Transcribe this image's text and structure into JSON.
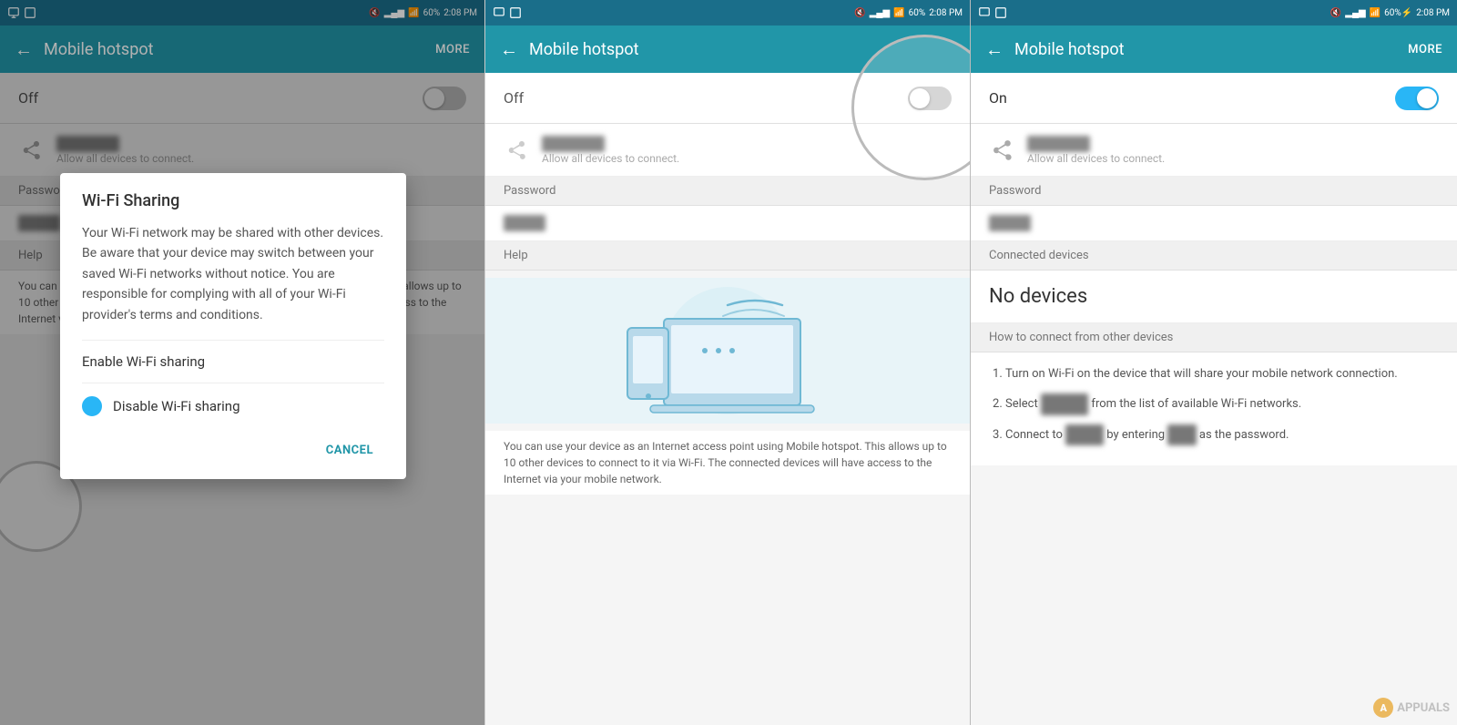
{
  "panel1": {
    "status": {
      "time": "2:08 PM",
      "battery": "60%",
      "signal": "4G"
    },
    "header": {
      "title": "Mobile hotspot",
      "more": "MORE",
      "back": "←"
    },
    "toggle": {
      "label": "Off",
      "state": "off"
    },
    "dialog": {
      "title": "Wi-Fi Sharing",
      "body": "Your Wi-Fi network may be shared with other devices. Be aware that your device may switch between your saved Wi-Fi networks without notice. You are responsible for complying with all of your Wi-Fi provider's terms and conditions.",
      "option1": "Enable Wi-Fi sharing",
      "option2": "Disable Wi-Fi sharing",
      "cancel": "CANCEL"
    },
    "footer_text": "You can use your device as an Internet access point using Mobile hotspot. This allows up to 10 other devices to connect to it via Wi-Fi. The connected devices will have access to the Internet via your mobile network."
  },
  "panel2": {
    "status": {
      "time": "2:08 PM",
      "battery": "60%"
    },
    "header": {
      "title": "Mobile hotspot",
      "back": "←"
    },
    "toggle": {
      "label": "Off",
      "state": "off"
    },
    "network_label": "Allow all devices to connect.",
    "password_label": "Password",
    "help_label": "Help",
    "help_text": "You can use your device as an Internet access point using Mobile hotspot. This allows up to 10 other devices to connect to it via Wi-Fi. The connected devices will have access to the Internet via your mobile network."
  },
  "panel3": {
    "status": {
      "time": "2:08 PM",
      "battery": "60%"
    },
    "header": {
      "title": "Mobile hotspot",
      "more": "MORE",
      "back": "←"
    },
    "toggle": {
      "label": "On",
      "state": "on"
    },
    "network_label": "Allow all devices to connect.",
    "password_label": "Password",
    "connected_devices_label": "Connected devices",
    "no_devices": "No devices",
    "how_to_label": "How to connect from other devices",
    "instructions": [
      "Turn on Wi-Fi on the device that will share your mobile network connection.",
      "Select [network] from the list of available Wi-Fi networks.",
      "Connect to [network] by entering [password] as the password."
    ]
  }
}
